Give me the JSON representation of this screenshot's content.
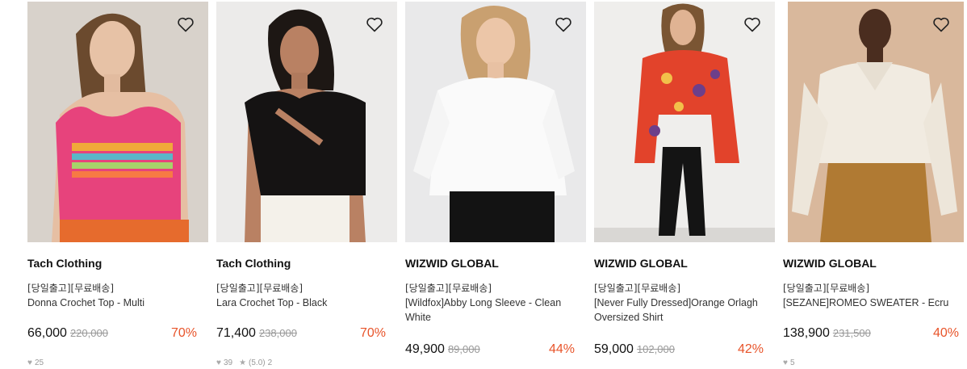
{
  "products": [
    {
      "brand": "Tach Clothing",
      "tag": "[당일출고][무료배송]",
      "name": "Donna Crochet Top - Multi",
      "price": "66,000",
      "original_price": "220,000",
      "discount": "70%",
      "likes": "25",
      "rating": "",
      "reviews": ""
    },
    {
      "brand": "Tach Clothing",
      "tag": "[당일출고][무료배송]",
      "name": "Lara Crochet Top - Black",
      "price": "71,400",
      "original_price": "238,000",
      "discount": "70%",
      "likes": "39",
      "rating": "(5.0)",
      "reviews": "2"
    },
    {
      "brand": "WIZWID GLOBAL",
      "tag": "[당일출고][무료배송]",
      "name": "[Wildfox]Abby Long Sleeve - Clean White",
      "price": "49,900",
      "original_price": "89,000",
      "discount": "44%",
      "likes": "",
      "rating": "",
      "reviews": ""
    },
    {
      "brand": "WIZWID GLOBAL",
      "tag": "[당일출고][무료배송]",
      "name": "[Never Fully Dressed]Orange Orlagh Oversized Shirt",
      "price": "59,000",
      "original_price": "102,000",
      "discount": "42%",
      "likes": "",
      "rating": "",
      "reviews": ""
    },
    {
      "brand": "WIZWID GLOBAL",
      "tag": "[당일출고][무료배송]",
      "name": "[SEZANE]ROMEO SWEATER - Ecru",
      "price": "138,900",
      "original_price": "231,500",
      "discount": "40%",
      "likes": "5",
      "rating": "",
      "reviews": ""
    }
  ],
  "colors": {
    "discount": "#e8542a",
    "original_price": "#999999",
    "brand": "#111111"
  },
  "icons": {
    "wishlist": "heart-outline-icon",
    "likes": "heart-icon",
    "rating": "star-icon"
  }
}
